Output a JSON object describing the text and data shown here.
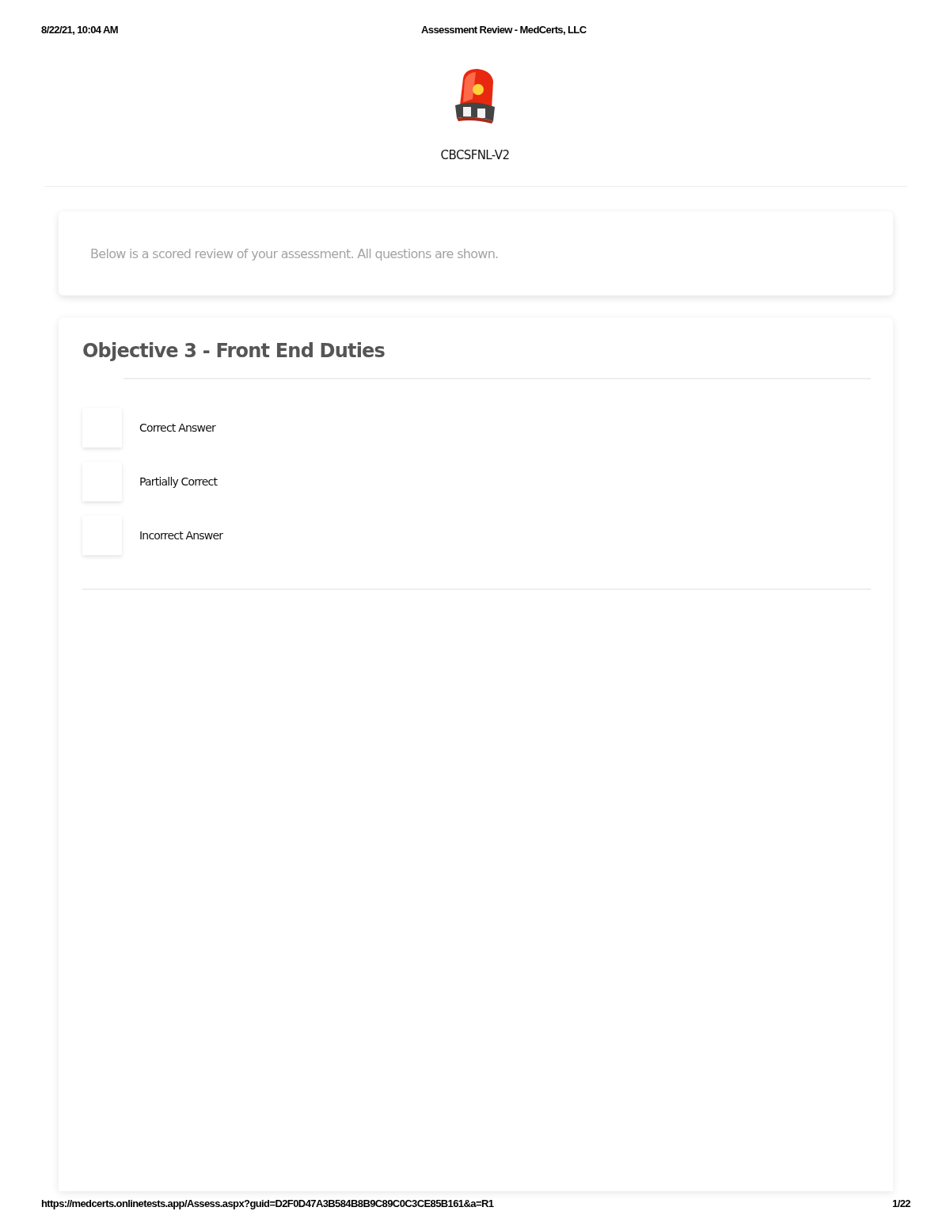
{
  "print_header": {
    "date": "8/22/21, 10:04 AM",
    "title": "Assessment Review - MedCerts, LLC"
  },
  "assessment": {
    "code": "CBCSFNL-V2"
  },
  "intro": {
    "text": "Below is a scored review of your assessment. All questions are shown."
  },
  "section": {
    "title": "Objective 3 - Front End Duties",
    "legend": [
      {
        "label": "Correct Answer"
      },
      {
        "label": "Partially Correct"
      },
      {
        "label": "Incorrect Answer"
      }
    ]
  },
  "print_footer": {
    "url": "https://medcerts.onlinetests.app/Assess.aspx?guid=D2F0D47A3B584B8B9C89C0C3CE85B161&a=R1",
    "page": "1/22"
  }
}
